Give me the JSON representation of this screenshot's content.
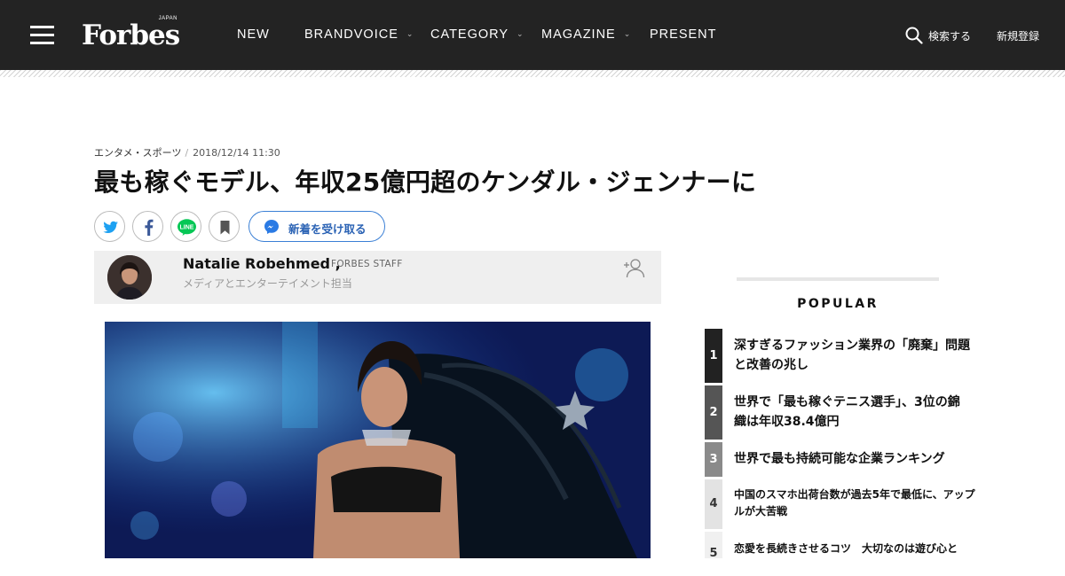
{
  "header": {
    "logo": "Forbes",
    "logo_sub": "JAPAN",
    "nav": [
      {
        "label": "NEW",
        "has_caret": false
      },
      {
        "label": "BRANDVOICE",
        "has_caret": true
      },
      {
        "label": "CATEGORY",
        "has_caret": true
      },
      {
        "label": "MAGAZINE",
        "has_caret": true
      },
      {
        "label": "PRESENT",
        "has_caret": false
      }
    ],
    "search_label": "検索する",
    "register_label": "新規登録"
  },
  "article": {
    "category": "エンタメ・スポーツ",
    "date": "2018/12/14 11:30",
    "title": "最も稼ぐモデル、年収25億円超のケンダル・ジェンナーに",
    "subscribe_label": "新着を受け取る",
    "share_icons": [
      "twitter-icon",
      "facebook-icon",
      "line-icon",
      "bookmark-icon"
    ]
  },
  "author": {
    "name": "Natalie Robehmed ,",
    "role": "FORBES STAFF",
    "description": "メディアとエンターテイメント担当"
  },
  "popular": {
    "title": "POPULAR",
    "items": [
      {
        "rank": "1",
        "text_line1": "深すぎるファッション業界の「廃棄」問題",
        "text_line2": "と改善の兆し"
      },
      {
        "rank": "2",
        "text_line1": "世界で「最も稼ぐテニス選手」、3位の錦",
        "text_line2": "織は年収38.4億円"
      },
      {
        "rank": "3",
        "text_line1": "世界で最も持続可能な企業ランキング",
        "text_line2": ""
      },
      {
        "rank": "4",
        "text_line1": "中国のスマホ出荷台数が過去5年で最低に、アップ",
        "text_line2": "ルが大苦戦"
      },
      {
        "rank": "5",
        "text_line1": "恋愛を長続きさせるコツ　大切なのは遊び心と",
        "text_line2": ""
      }
    ]
  },
  "colors": {
    "header_bg": "#232323",
    "accent_blue": "#1da1f2",
    "facebook_blue": "#3b5998",
    "line_green": "#06c755",
    "messenger_blue": "#2a62b4"
  }
}
